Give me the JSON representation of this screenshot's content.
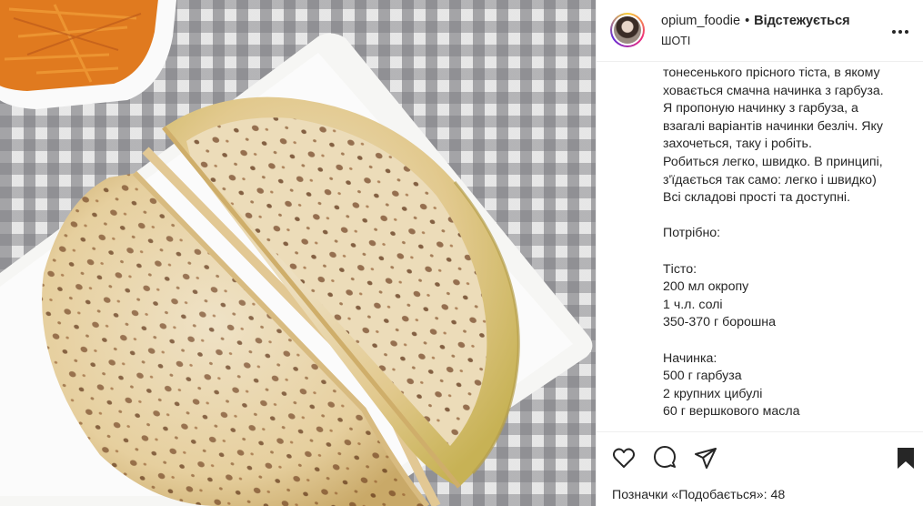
{
  "post": {
    "username": "opium_foodie",
    "separator": "•",
    "follow_label": "Відстежується",
    "location": "ШОТІ",
    "more_icon": "more-horizontal-icon",
    "caption_lines": [
      "тонесенького прісного тіста, в якому",
      "ховається смачна начинка з гарбуза.",
      "Я пропоную начинку з гарбуза, а",
      "взагалі варіантів начинки безліч. Яку",
      "захочеться, таку і робіть.",
      "Робиться легко, швидко. В принципі,",
      "з'їдається так само: легко і швидко)",
      "Всі складові прості та доступні.",
      "",
      "Потрібно:",
      "",
      "Тісто:",
      "200 мл окропу",
      "1 ч.л. солі",
      "350-370 г борошна",
      "",
      "Начинка:",
      "500 г гарбуза",
      "2 крупних цибулі",
      "60 г вершкового масла"
    ],
    "likes_label": "Позначки «Подобається»: 48",
    "icons": {
      "like": "heart-icon",
      "comment": "comment-icon",
      "share": "share-icon",
      "save": "bookmark-icon"
    }
  },
  "colors": {
    "text": "#262626",
    "border": "#efefef",
    "plate": "#f7f7f5",
    "flatbread": "#e9cf96"
  }
}
